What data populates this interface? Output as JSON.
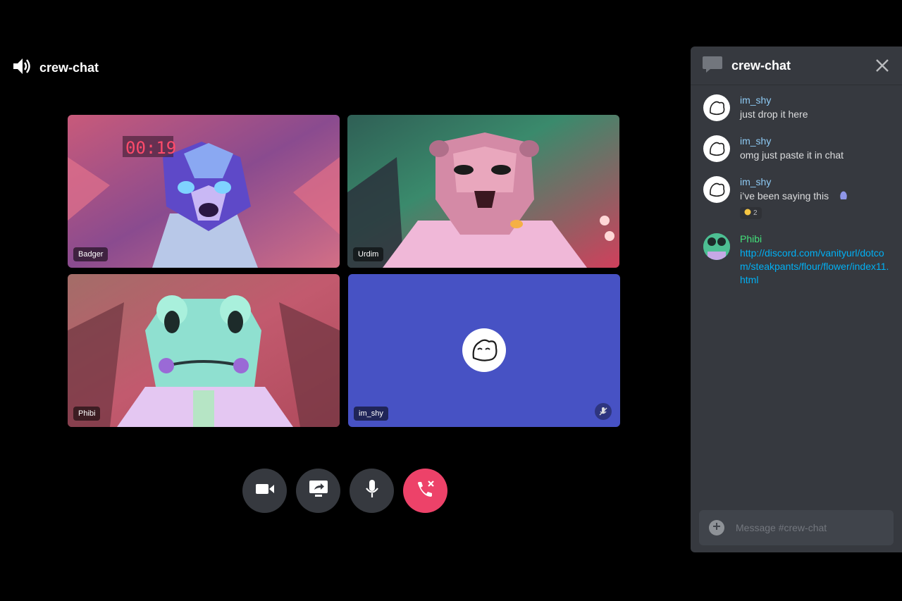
{
  "call": {
    "channel_name": "crew-chat",
    "icon": "speaker-icon"
  },
  "tiles": [
    {
      "name": "Badger"
    },
    {
      "name": "Urdim"
    },
    {
      "name": "Phibi"
    },
    {
      "name": "im_shy",
      "muted": true
    }
  ],
  "controls": {
    "camera": "camera-icon",
    "share": "screen-share-icon",
    "mic": "microphone-icon",
    "end": "end-call-icon"
  },
  "chat": {
    "title": "crew-chat",
    "messages": [
      {
        "author": "im_shy",
        "text": "just drop it here"
      },
      {
        "author": "im_shy",
        "text": "omg just paste it in chat"
      },
      {
        "author": "im_shy",
        "text": "i’ve been saying this",
        "reaction_count": "2"
      },
      {
        "author": "Phibi",
        "text": "http://discord.com/vanityurl/dotcom/steakpants/flour/flower/index11.html"
      }
    ],
    "composer_placeholder": "Message #crew-chat"
  },
  "colors": {
    "background": "#000000",
    "panel": "#36393f",
    "end_call": "#ed4269",
    "tile_blue": "#4752c4",
    "link": "#00b0f4",
    "green_name": "#43e07a"
  }
}
